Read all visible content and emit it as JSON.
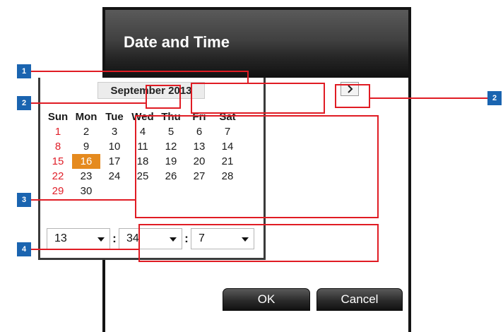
{
  "dialog": {
    "title": "Date and Time",
    "month_label": "September 2013",
    "prev_icon": "chevron-left-icon",
    "next_icon": "chevron-right-icon",
    "weekdays": [
      "Sun",
      "Mon",
      "Tue",
      "Wed",
      "Thu",
      "Fri",
      "Sat"
    ],
    "weeks": [
      [
        "1",
        "2",
        "3",
        "4",
        "5",
        "6",
        "7"
      ],
      [
        "8",
        "9",
        "10",
        "11",
        "12",
        "13",
        "14"
      ],
      [
        "15",
        "16",
        "17",
        "18",
        "19",
        "20",
        "21"
      ],
      [
        "22",
        "23",
        "24",
        "25",
        "26",
        "27",
        "28"
      ],
      [
        "29",
        "30",
        "",
        "",
        "",
        "",
        ""
      ]
    ],
    "selected_day": "16",
    "time": {
      "hour": "13",
      "minute": "34",
      "second": "7",
      "separator": ":"
    },
    "ok_label": "OK",
    "cancel_label": "Cancel"
  },
  "callouts": {
    "month_header": "1",
    "prev_arrow": "2",
    "next_arrow": "2",
    "calendar_grid": "3",
    "time_selectors": "4"
  },
  "colors": {
    "selected_day_bg": "#e58a1e",
    "sunday_text": "#e0202a",
    "callout_bg": "#1a64b0",
    "highlight_border": "#e01c24"
  }
}
